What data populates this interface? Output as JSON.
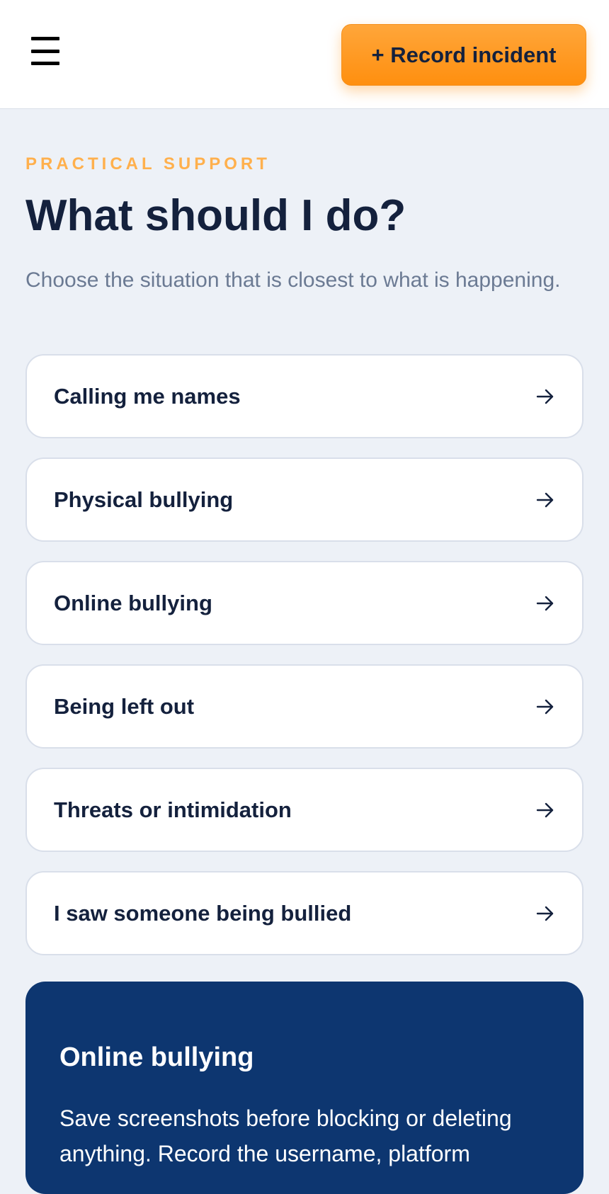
{
  "header": {
    "menu_icon": "hamburger-menu-icon",
    "record_button_label": "+ Record incident",
    "accent_color": "#ff9a1f"
  },
  "eyebrow": "PRACTICAL SUPPORT",
  "title": "What should I do?",
  "intro": "Choose the situation that is closest to what is happening.",
  "options": [
    {
      "label": "Calling me names",
      "icon": "arrow-right-icon"
    },
    {
      "label": "Physical bullying",
      "icon": "arrow-right-icon"
    },
    {
      "label": "Online bullying",
      "icon": "arrow-right-icon"
    },
    {
      "label": "Being left out",
      "icon": "arrow-right-icon"
    },
    {
      "label": "Threats or intimidation",
      "icon": "arrow-right-icon"
    },
    {
      "label": "I saw someone being bullied",
      "icon": "arrow-right-icon"
    }
  ],
  "panel": {
    "title": "Online bullying",
    "text": "Save screenshots before blocking or deleting anything. Record the username, platform",
    "background": "#0d3670"
  }
}
